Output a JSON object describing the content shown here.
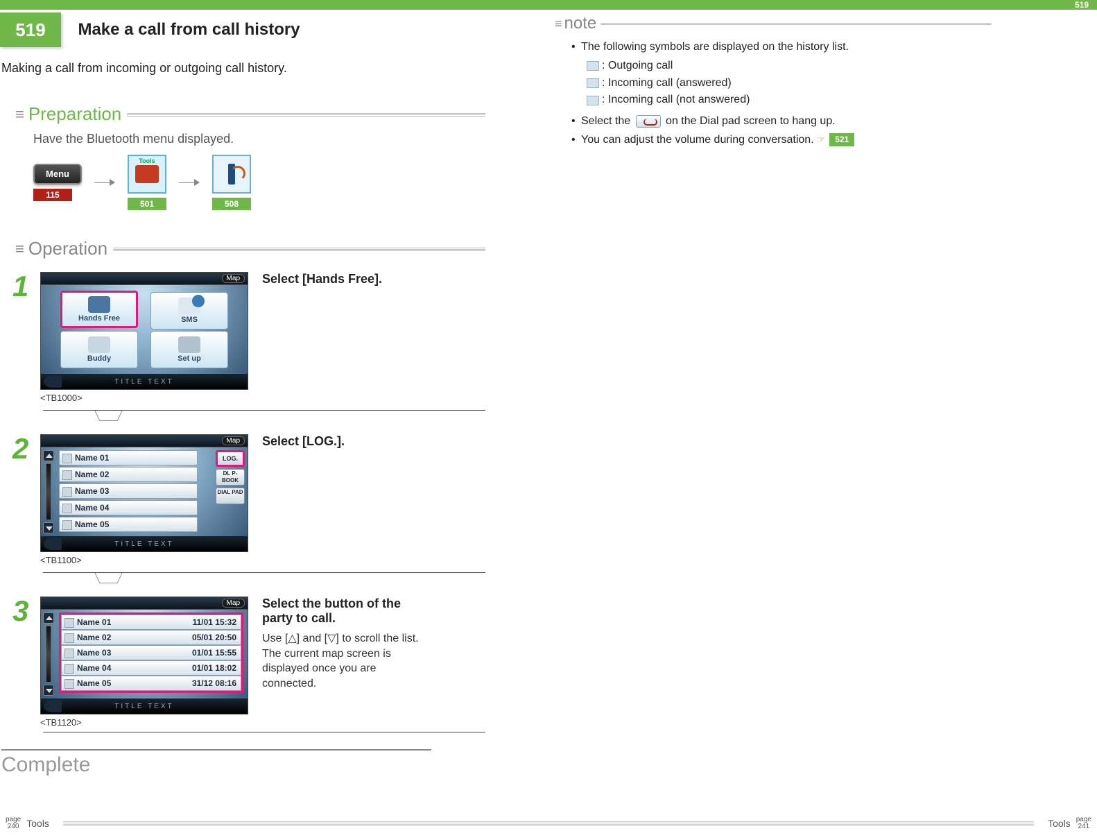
{
  "header": {
    "badge_num": "519",
    "top_right_num": "519",
    "title": "Make a call from call history",
    "intro": "Making a call from incoming or outgoing call history."
  },
  "preparation": {
    "label": "Preparation",
    "text": "Have the Bluetooth menu displayed.",
    "menu_label": "Menu",
    "tools_label": "Tools",
    "refs": {
      "menu": "115",
      "tools": "501",
      "bluetooth": "508"
    }
  },
  "operation": {
    "label": "Operation",
    "complete": "Complete",
    "shared": {
      "map_btn": "Map",
      "title_text": "TITLE TEXT"
    },
    "steps": [
      {
        "num": "1",
        "id": "<TB1000>",
        "title": "Select [Hands Free].",
        "body": "",
        "buttons": {
          "hf": "Hands Free",
          "sms": "SMS",
          "buddy": "Buddy",
          "setup": "Set up"
        }
      },
      {
        "num": "2",
        "id": "<TB1100>",
        "title": "Select [LOG.].",
        "body": "",
        "list": [
          "Name 01",
          "Name 02",
          "Name 03",
          "Name 04",
          "Name 05"
        ],
        "side": {
          "log": "LOG.",
          "pbook": "DL P-BOOK",
          "dialpad": "DIAL PAD"
        }
      },
      {
        "num": "3",
        "id": "<TB1120>",
        "title": "Select the button of the party to call.",
        "body": "Use [△] and [▽] to scroll the list.\nThe current map screen is displayed once you are connected.",
        "rows": [
          {
            "name": "Name 01",
            "when": "11/01 15:32"
          },
          {
            "name": "Name 02",
            "when": "05/01 20:50"
          },
          {
            "name": "Name 03",
            "when": "01/01 15:55"
          },
          {
            "name": "Name 04",
            "when": "01/01 18:02"
          },
          {
            "name": "Name 05",
            "when": "31/12 08:16"
          }
        ]
      }
    ]
  },
  "note": {
    "label": "note",
    "items": {
      "symbols_line": "The following symbols are displayed on the history list.",
      "symbol_out": ": Outgoing call",
      "symbol_in_ans": ": Incoming call (answered)",
      "symbol_in_noans": ": Incoming call (not answered)",
      "hangup_pre": "Select the ",
      "hangup_post": " on the Dial pad screen to hang up.",
      "volume": "You can adjust the volume during conversation.",
      "volume_ref": "521"
    }
  },
  "footer": {
    "page_word": "page",
    "left_num": "240",
    "right_num": "241",
    "tools": "Tools"
  }
}
